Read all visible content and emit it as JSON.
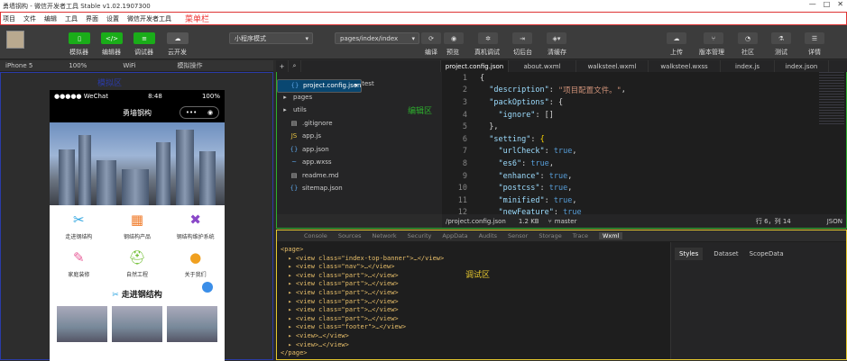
{
  "window": {
    "title": "勇墙钢构 - 微信开发者工具 Stable v1.02.1907300",
    "controls": [
      "—",
      "□",
      "✕"
    ]
  },
  "menubar": {
    "items": [
      "项目",
      "文件",
      "编辑",
      "工具",
      "界面",
      "设置",
      "微信开发者工具"
    ],
    "annotation": "菜单栏"
  },
  "toolbar": {
    "mode_buttons": [
      {
        "label": "模拟器",
        "icon": "phone-icon"
      },
      {
        "label": "编辑器",
        "icon": "code-icon"
      },
      {
        "label": "调试器",
        "icon": "debug-icon"
      },
      {
        "label": "云开发",
        "icon": "cloud-icon"
      }
    ],
    "mode_select": "小程序模式",
    "page_select": "pages/index/index",
    "actions": [
      "编译",
      "预览",
      "真机调试",
      "切后台",
      "清缓存"
    ],
    "right_actions": [
      "上传",
      "版本管理",
      "社区",
      "测试",
      "详情"
    ]
  },
  "simbar": {
    "device": "iPhone 5",
    "zoom": "100%",
    "network": "WiFi",
    "op": "模拟操作"
  },
  "simulator": {
    "annotation": "模拟区",
    "status": {
      "carrier": "●●●●● WeChat",
      "time": "8:48",
      "battery": "100%"
    },
    "nav_title": "勇墙钢构",
    "grid": [
      {
        "label": "走进钢结构",
        "icon": "✂",
        "color": "#2aa3e0"
      },
      {
        "label": "钢结构产品",
        "icon": "▦",
        "color": "#f07a28"
      },
      {
        "label": "钢结构维护系统",
        "icon": "✖",
        "color": "#8a48c8"
      },
      {
        "label": "家庭装修",
        "icon": "✎",
        "color": "#e8609a"
      },
      {
        "label": "自然工程",
        "icon": "⛑",
        "color": "#6cbc2c"
      },
      {
        "label": "关于我们",
        "icon": "●",
        "color": "#f0a020"
      }
    ],
    "section_title": "走进钢结构"
  },
  "editor": {
    "tabs": [
      "project.config.json",
      "about.wxml",
      "walksteel.wxml",
      "walksteel.wxss",
      "index.js",
      "index.json"
    ],
    "annotation": "编辑区",
    "tree": [
      {
        "name": "cloudfunction | yruijy-test",
        "icon": "▾",
        "type": "folder"
      },
      {
        "name": "pages",
        "icon": "▸",
        "type": "folder"
      },
      {
        "name": "utils",
        "icon": "▸",
        "type": "folder"
      },
      {
        "name": ".gitignore",
        "icon": "▤",
        "type": "file"
      },
      {
        "name": "app.js",
        "icon": "JS",
        "type": "js"
      },
      {
        "name": "app.json",
        "icon": "{}",
        "type": "json"
      },
      {
        "name": "app.wxss",
        "icon": "~",
        "type": "wxss"
      },
      {
        "name": "project.config.json",
        "icon": "{}",
        "type": "json"
      },
      {
        "name": "readme.md",
        "icon": "▤",
        "type": "file"
      },
      {
        "name": "sitemap.json",
        "icon": "{}",
        "type": "json"
      }
    ],
    "code_lines": [
      [
        "1",
        [
          [
            "p",
            "{"
          ]
        ]
      ],
      [
        "2",
        [
          [
            "p",
            "  "
          ],
          [
            "k",
            "\"description\""
          ],
          [
            "p",
            ": "
          ],
          [
            "s",
            "\"项目配置文件。\""
          ],
          [
            "p",
            ","
          ]
        ]
      ],
      [
        "3",
        [
          [
            "p",
            "  "
          ],
          [
            "k",
            "\"packOptions\""
          ],
          [
            "p",
            ": {"
          ]
        ]
      ],
      [
        "4",
        [
          [
            "p",
            "    "
          ],
          [
            "k",
            "\"ignore\""
          ],
          [
            "p",
            ": []"
          ]
        ]
      ],
      [
        "5",
        [
          [
            "p",
            "  },"
          ]
        ]
      ],
      [
        "6",
        [
          [
            "p",
            "  "
          ],
          [
            "k",
            "\"setting\""
          ],
          [
            "p",
            ": "
          ],
          [
            "y",
            "{"
          ]
        ]
      ],
      [
        "7",
        [
          [
            "p",
            "    "
          ],
          [
            "k",
            "\"urlCheck\""
          ],
          [
            "p",
            ": "
          ],
          [
            "b",
            "true"
          ],
          [
            "p",
            ","
          ]
        ]
      ],
      [
        "8",
        [
          [
            "p",
            "    "
          ],
          [
            "k",
            "\"es6\""
          ],
          [
            "p",
            ": "
          ],
          [
            "b",
            "true"
          ],
          [
            "p",
            ","
          ]
        ]
      ],
      [
        "9",
        [
          [
            "p",
            "    "
          ],
          [
            "k",
            "\"enhance\""
          ],
          [
            "p",
            ": "
          ],
          [
            "b",
            "true"
          ],
          [
            "p",
            ","
          ]
        ]
      ],
      [
        "10",
        [
          [
            "p",
            "    "
          ],
          [
            "k",
            "\"postcss\""
          ],
          [
            "p",
            ": "
          ],
          [
            "b",
            "true"
          ],
          [
            "p",
            ","
          ]
        ]
      ],
      [
        "11",
        [
          [
            "p",
            "    "
          ],
          [
            "k",
            "\"minified\""
          ],
          [
            "p",
            ": "
          ],
          [
            "b",
            "true"
          ],
          [
            "p",
            ","
          ]
        ]
      ],
      [
        "12",
        [
          [
            "p",
            "    "
          ],
          [
            "k",
            "\"newFeature\""
          ],
          [
            "p",
            ": "
          ],
          [
            "b",
            "true"
          ]
        ]
      ]
    ],
    "status": {
      "path": "/project.config.json",
      "size": "1.2 KB",
      "branch": "master",
      "pos": "行 6，列 14",
      "lang": "JSON"
    }
  },
  "debug": {
    "annotation": "调试区",
    "tabs": [
      "Console",
      "Sources",
      "Network",
      "Security",
      "AppData",
      "Audits",
      "Sensor",
      "Storage",
      "Trace",
      "Wxml"
    ],
    "active_tab": "Wxml",
    "side_tabs": [
      "Styles",
      "Dataset",
      "ScopeData"
    ],
    "dom": [
      "<page>",
      "  ▸ <view class=\"index-top-banner\">…</view>",
      "  ▸ <view class=\"nav\">…</view>",
      "  ▸ <view class=\"part\">…</view>",
      "  ▸ <view class=\"part\">…</view>",
      "  ▸ <view class=\"part\">…</view>",
      "  ▸ <view class=\"part\">…</view>",
      "  ▸ <view class=\"part\">…</view>",
      "  ▸ <view class=\"part\">…</view>",
      "  ▸ <view class=\"footer\">…</view>",
      "  ▸ <view>…</view>",
      "  ▸ <view>…</view>",
      "</page>"
    ]
  }
}
